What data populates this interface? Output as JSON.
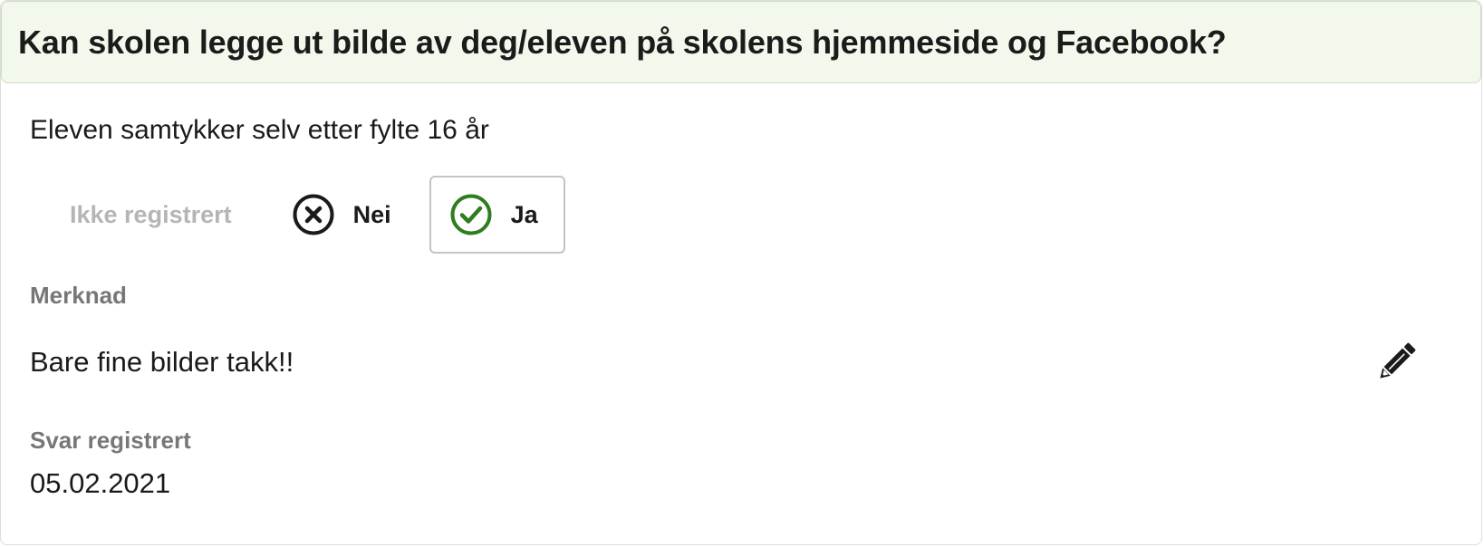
{
  "question": {
    "title": "Kan skolen legge ut bilde av deg/eleven på skolens hjemmeside og Facebook?"
  },
  "consent_info": "Eleven samtykker selv etter fylte 16 år",
  "options": {
    "not_registered": {
      "label": "Ikke registrert",
      "selected": false
    },
    "no": {
      "label": "Nei",
      "icon": "x-circle-icon",
      "selected": false
    },
    "yes": {
      "label": "Ja",
      "icon": "check-circle-icon",
      "selected": true
    }
  },
  "note": {
    "label": "Merknad",
    "text": "Bare fine bilder takk!!",
    "edit_icon": "pencil-icon"
  },
  "registered": {
    "label": "Svar registrert",
    "date": "05.02.2021"
  },
  "colors": {
    "header_bg": "#f2f9ec",
    "check_green": "#2e7d1f",
    "muted_text": "#b5b5b5",
    "label_gray": "#777777"
  }
}
